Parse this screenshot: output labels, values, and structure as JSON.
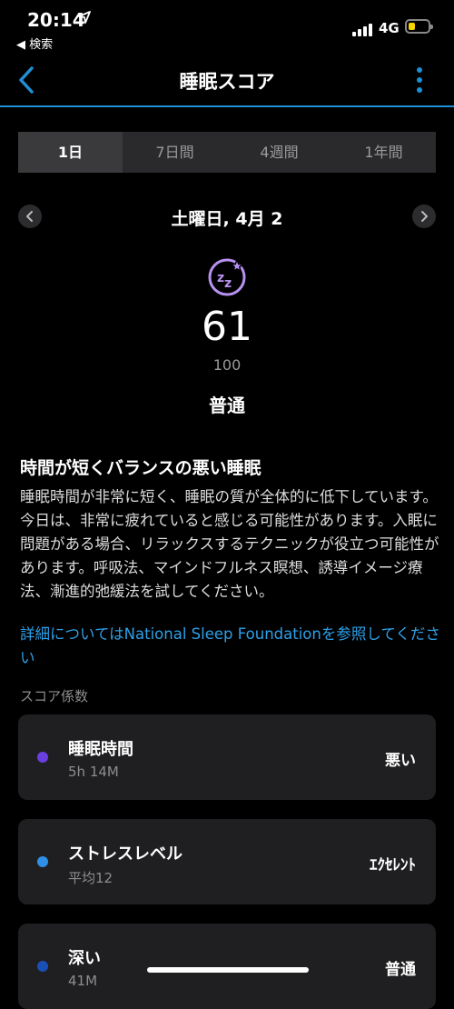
{
  "status_bar": {
    "time": "20:14",
    "back_label": "◀ 検索",
    "network": "4G"
  },
  "nav": {
    "title": "睡眠スコア"
  },
  "tabs": [
    {
      "label": "1日",
      "active": true
    },
    {
      "label": "7日間",
      "active": false
    },
    {
      "label": "4週間",
      "active": false
    },
    {
      "label": "1年間",
      "active": false
    }
  ],
  "date": "土曜日, 4月 2",
  "score": {
    "value": "61",
    "max": "100",
    "rating": "普通"
  },
  "summary": {
    "headline": "時間が短くバランスの悪い睡眠",
    "description": "睡眠時間が非常に短く、睡眠の質が全体的に低下しています。今日は、非常に疲れていると感じる可能性があります。入眠に問題がある場合、リラックスするテクニックが役立つ可能性があります。呼吸法、マインドフルネス瞑想、誘導イメージ療法、漸進的弛緩法を試してください。",
    "link": "詳細についてはNational Sleep Foundationを参照してください"
  },
  "factors": {
    "section_label": "スコア係数",
    "items": [
      {
        "title": "睡眠時間",
        "sub": "5h 14M",
        "value": "悪い",
        "color": "#6a3fe0"
      },
      {
        "title": "ストレスレベル",
        "sub": "平均12",
        "value": "ｴｸｾﾚﾝﾄ",
        "color": "#2f8fe6"
      },
      {
        "title": "深い",
        "sub": "41M",
        "value": "普通",
        "color": "#1a4fb5"
      }
    ]
  },
  "colors": {
    "accent": "#1f8fd6",
    "link": "#2ea0e8",
    "sleep_icon": "#b892f0"
  }
}
